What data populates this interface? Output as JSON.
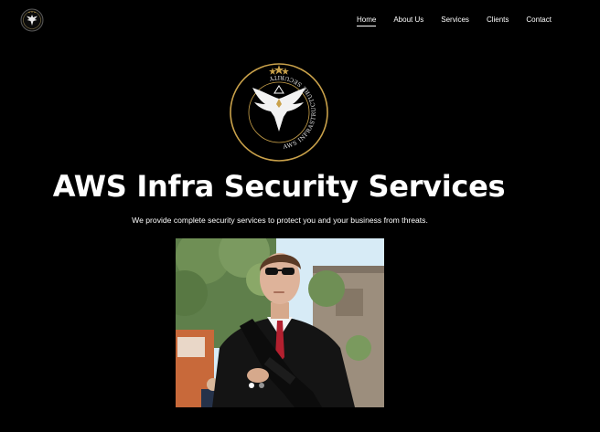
{
  "nav": {
    "items": [
      {
        "label": "Home",
        "active": true
      },
      {
        "label": "About Us",
        "active": false
      },
      {
        "label": "Services",
        "active": false
      },
      {
        "label": "Clients",
        "active": false
      },
      {
        "label": "Contact",
        "active": false
      }
    ]
  },
  "hero": {
    "logo_text": "AWS INFRASTRUCTURE SECURITY",
    "title": "AWS Infra Security Services",
    "subtitle": "We provide complete security services to protect you and your business from threats.",
    "slider": {
      "total": 2,
      "active_index": 0
    }
  },
  "colors": {
    "background": "#000000",
    "text": "#ffffff",
    "logo_gold": "#c9a14a"
  }
}
